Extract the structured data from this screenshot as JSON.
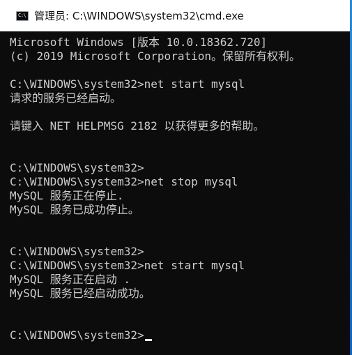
{
  "window": {
    "title": "管理员: C:\\WINDOWS\\system32\\cmd.exe",
    "icon": "cmd-icon",
    "icon_text": "C:\\"
  },
  "console": {
    "lines": [
      "Microsoft Windows [版本 10.0.18362.720]",
      "(c) 2019 Microsoft Corporation。保留所有权利。",
      "",
      "C:\\WINDOWS\\system32>net start mysql",
      "请求的服务已经启动。",
      "",
      "请键入 NET HELPMSG 2182 以获得更多的帮助。",
      "",
      "",
      "C:\\WINDOWS\\system32>",
      "C:\\WINDOWS\\system32>net stop mysql",
      "MySQL 服务正在停止.",
      "MySQL 服务已成功停止。",
      "",
      "",
      "C:\\WINDOWS\\system32>",
      "C:\\WINDOWS\\system32>net start mysql",
      "MySQL 服务正在启动 .",
      "MySQL 服务已经启动成功。",
      "",
      "",
      "C:\\WINDOWS\\system32>"
    ]
  },
  "colors": {
    "console_bg": "#0c0c0c",
    "console_text": "#cccccc",
    "titlebar_bg": "#ffffff",
    "accent": "#1e78d4"
  }
}
